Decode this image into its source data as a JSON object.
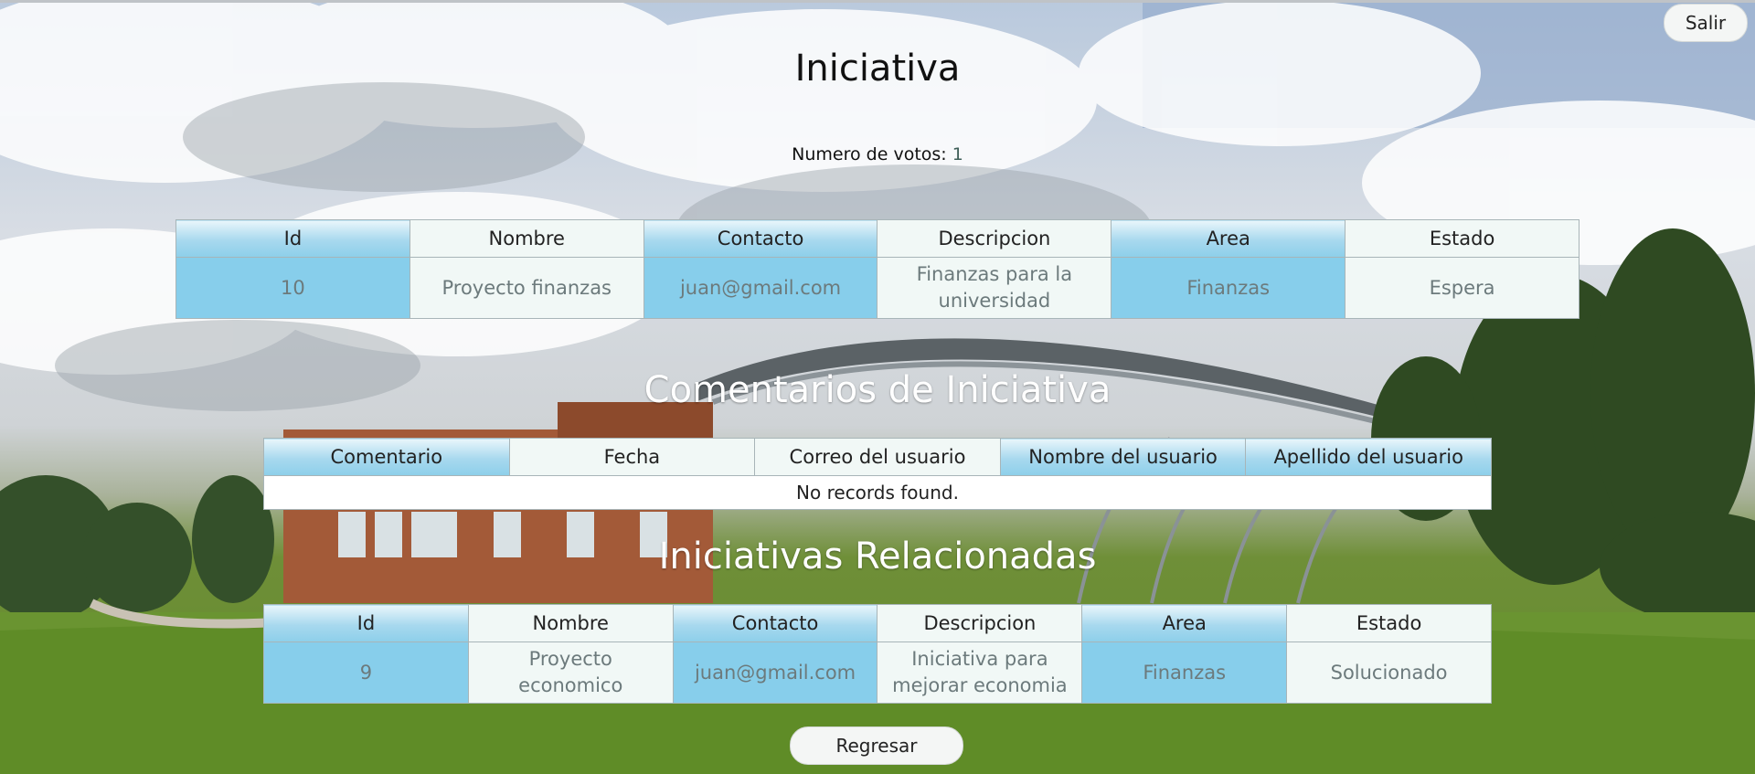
{
  "header": {
    "logout_label": "Salir",
    "title": "Iniciativa",
    "votes_label": "Numero de votos:",
    "votes_value": "1"
  },
  "initiative_table": {
    "columns": [
      "Id",
      "Nombre",
      "Contacto",
      "Descripcion",
      "Area",
      "Estado"
    ],
    "rows": [
      [
        "10",
        "Proyecto finanzas",
        "juan@gmail.com",
        "Finanzas para la universidad",
        "Finanzas",
        "Espera"
      ]
    ]
  },
  "comments": {
    "title": "Comentarios de Iniciativa",
    "columns": [
      "Comentario",
      "Fecha",
      "Correo del usuario",
      "Nombre del usuario",
      "Apellido del usuario"
    ],
    "empty_message": "No records found."
  },
  "related": {
    "title": "Iniciativas Relacionadas",
    "columns": [
      "Id",
      "Nombre",
      "Contacto",
      "Descripcion",
      "Area",
      "Estado"
    ],
    "rows": [
      [
        "9",
        "Proyecto economico",
        "juan@gmail.com",
        "Iniciativa para mejorar economia",
        "Finanzas",
        "Solucionado"
      ]
    ]
  },
  "footer": {
    "back_label": "Regresar"
  },
  "colors": {
    "accent_blue": "#87ceeb",
    "cell_light": "#f1f8f6"
  }
}
